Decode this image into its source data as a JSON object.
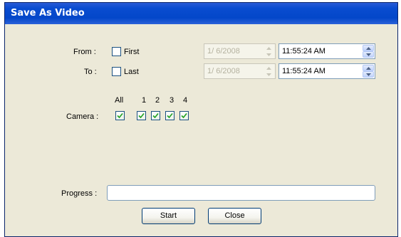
{
  "window": {
    "title": "Save As Video"
  },
  "from": {
    "label": "From :",
    "checkbox_label": "First",
    "checked": false,
    "date": "1/ 6/2008",
    "time": "11:55:24 AM"
  },
  "to": {
    "label": "To :",
    "checkbox_label": "Last",
    "checked": false,
    "date": "1/ 6/2008",
    "time": "11:55:24 AM"
  },
  "camera": {
    "label": "Camera :",
    "columns": [
      "All",
      "1",
      "2",
      "3",
      "4"
    ],
    "checked": [
      true,
      true,
      true,
      true,
      true
    ]
  },
  "progress": {
    "label": "Progress :",
    "fraction": 0
  },
  "buttons": {
    "start": "Start",
    "close": "Close"
  },
  "colors": {
    "title_bar": "#0a4cd0",
    "check_mark": "#21a121",
    "face": "#ece9d8"
  },
  "icons": {
    "spin_up": "chevron-up-icon",
    "spin_down": "chevron-down-icon",
    "check": "check-icon"
  }
}
